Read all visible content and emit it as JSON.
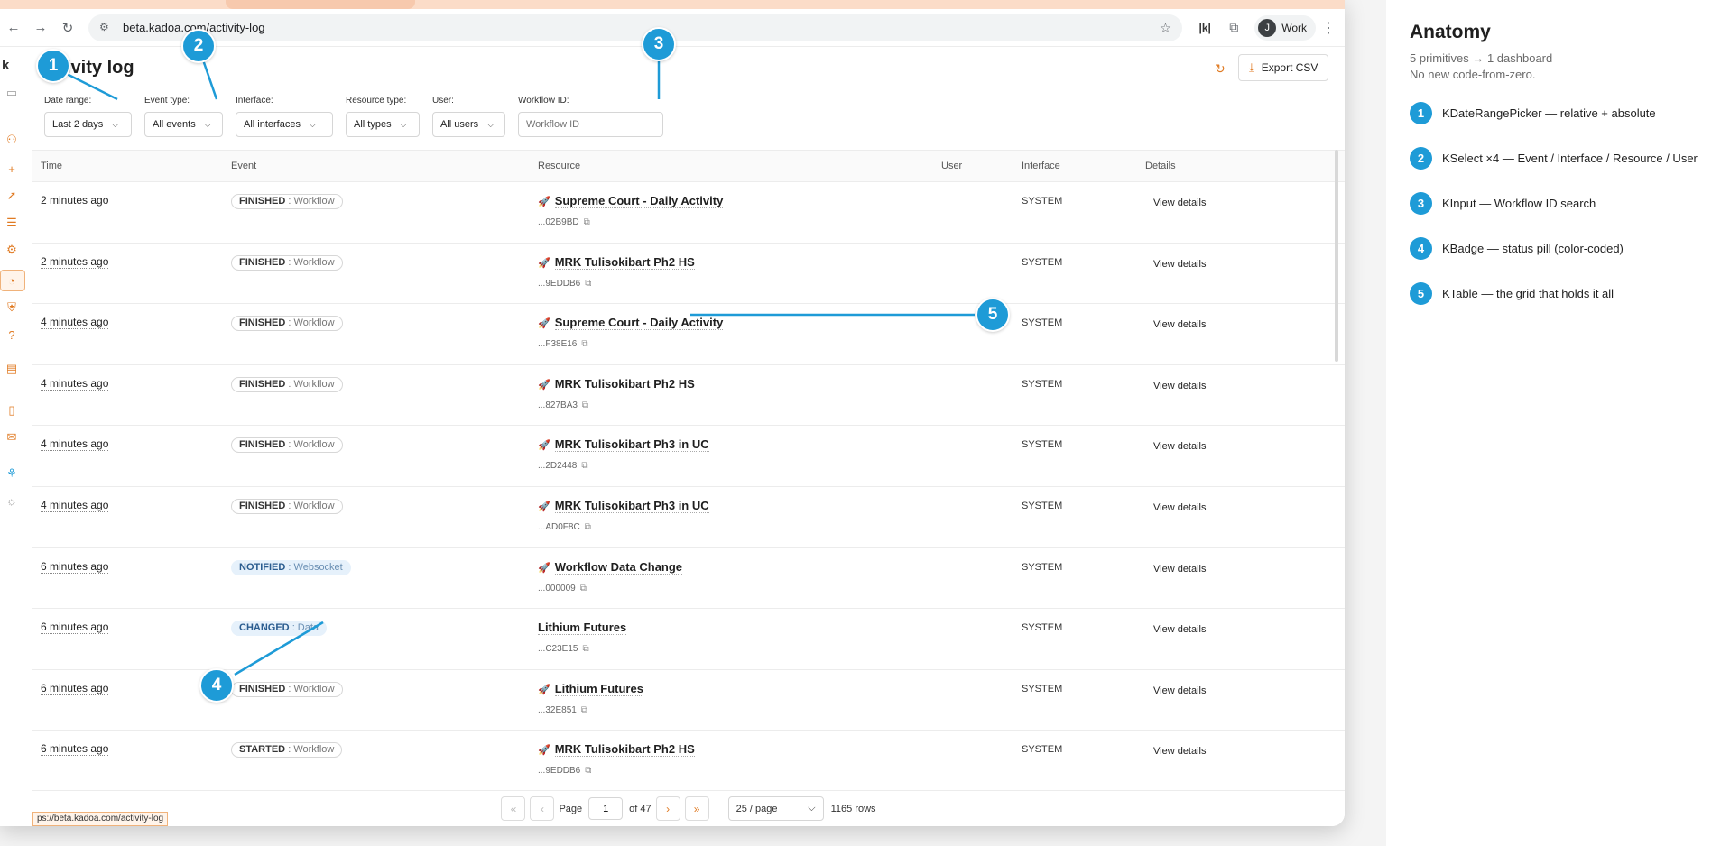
{
  "browser": {
    "url": "beta.kadoa.com/activity-log",
    "profile_initial": "J",
    "profile_label": "Work",
    "status_url": "ps://beta.kadoa.com/activity-log"
  },
  "app": {
    "logo": "k",
    "title": "ivity log",
    "export_label": "Export CSV",
    "filters": {
      "date_range": {
        "label": "Date range:",
        "value": "Last 2 days"
      },
      "event_type": {
        "label": "Event type:",
        "value": "All events"
      },
      "interface": {
        "label": "Interface:",
        "value": "All interfaces"
      },
      "resource_type": {
        "label": "Resource type:",
        "value": "All types"
      },
      "user": {
        "label": "User:",
        "value": "All users"
      },
      "workflow_id": {
        "label": "Workflow ID:",
        "placeholder": "Workflow ID"
      }
    },
    "table": {
      "columns": [
        "Time",
        "Event",
        "Resource",
        "User",
        "Interface",
        "Details"
      ],
      "rows": [
        {
          "time": "2 minutes ago",
          "event_status": "FINISHED",
          "event_type": ": Workflow",
          "resource": "Supreme Court - Daily Activity",
          "resource_id": "...02B9BD",
          "user": "",
          "interface": "SYSTEM",
          "details": "View details",
          "has_icon": true,
          "badge": "default"
        },
        {
          "time": "2 minutes ago",
          "event_status": "FINISHED",
          "event_type": ": Workflow",
          "resource": "MRK Tulisokibart Ph2 HS",
          "resource_id": "...9EDDB6",
          "user": "",
          "interface": "SYSTEM",
          "details": "View details",
          "has_icon": true,
          "badge": "default"
        },
        {
          "time": "4 minutes ago",
          "event_status": "FINISHED",
          "event_type": ": Workflow",
          "resource": "Supreme Court - Daily Activity",
          "resource_id": "...F38E16",
          "user": "",
          "interface": "SYSTEM",
          "details": "View details",
          "has_icon": true,
          "badge": "default"
        },
        {
          "time": "4 minutes ago",
          "event_status": "FINISHED",
          "event_type": ": Workflow",
          "resource": "MRK Tulisokibart Ph2 HS",
          "resource_id": "...827BA3",
          "user": "",
          "interface": "SYSTEM",
          "details": "View details",
          "has_icon": true,
          "badge": "default"
        },
        {
          "time": "4 minutes ago",
          "event_status": "FINISHED",
          "event_type": ": Workflow",
          "resource": "MRK Tulisokibart Ph3 in UC",
          "resource_id": "...2D2448",
          "user": "",
          "interface": "SYSTEM",
          "details": "View details",
          "has_icon": true,
          "badge": "default"
        },
        {
          "time": "4 minutes ago",
          "event_status": "FINISHED",
          "event_type": ": Workflow",
          "resource": "MRK Tulisokibart Ph3 in UC",
          "resource_id": "...AD0F8C",
          "user": "",
          "interface": "SYSTEM",
          "details": "View details",
          "has_icon": true,
          "badge": "default"
        },
        {
          "time": "6 minutes ago",
          "event_status": "NOTIFIED",
          "event_type": ": Websocket",
          "resource": "Workflow Data Change",
          "resource_id": "...000009",
          "user": "",
          "interface": "SYSTEM",
          "details": "View details",
          "has_icon": true,
          "badge": "blue"
        },
        {
          "time": "6 minutes ago",
          "event_status": "CHANGED",
          "event_type": ": Data",
          "resource": "Lithium Futures",
          "resource_id": "...C23E15",
          "user": "",
          "interface": "SYSTEM",
          "details": "View details",
          "has_icon": false,
          "badge": "blue"
        },
        {
          "time": "6 minutes ago",
          "event_status": "FINISHED",
          "event_type": ": Workflow",
          "resource": "Lithium Futures",
          "resource_id": "...32E851",
          "user": "",
          "interface": "SYSTEM",
          "details": "View details",
          "has_icon": true,
          "badge": "default"
        },
        {
          "time": "6 minutes ago",
          "event_status": "STARTED",
          "event_type": ": Workflow",
          "resource": "MRK Tulisokibart Ph2 HS",
          "resource_id": "...9EDDB6",
          "user": "",
          "interface": "SYSTEM",
          "details": "View details",
          "has_icon": true,
          "badge": "default"
        }
      ]
    },
    "pagination": {
      "page_label": "Page",
      "current_page": "1",
      "of_label": "of 47",
      "per_page": "25 / page",
      "rows_label": "1165 rows"
    }
  },
  "annotations": [
    "1",
    "2",
    "3",
    "4",
    "5"
  ],
  "anatomy": {
    "title": "Anatomy",
    "subtitle_1": "5 primitives → 1 dashboard",
    "subtitle_2": "No new code-from-zero.",
    "items": [
      {
        "num": "1",
        "text": "KDateRangePicker — relative + absolute"
      },
      {
        "num": "2",
        "text": "KSelect ×4 — Event / Interface / Resource / User"
      },
      {
        "num": "3",
        "text": "KInput — Workflow ID search"
      },
      {
        "num": "4",
        "text": "KBadge — status pill (color-coded)"
      },
      {
        "num": "5",
        "text": "KTable — the grid that holds it all"
      }
    ]
  },
  "colors": {
    "accent": "#e07a22",
    "callout": "#1e9bd7",
    "badge_blue_bg": "#e6f1fb"
  },
  "icons": [
    "back-icon",
    "forward-icon",
    "reload-icon",
    "site-info-icon",
    "star-icon",
    "extensions-icon",
    "menu-dots-icon",
    "refresh-icon",
    "download-icon",
    "chevron-down-icon",
    "rocket-icon",
    "copy-icon",
    "first-page-icon",
    "prev-page-icon",
    "next-page-icon",
    "last-page-icon"
  ]
}
